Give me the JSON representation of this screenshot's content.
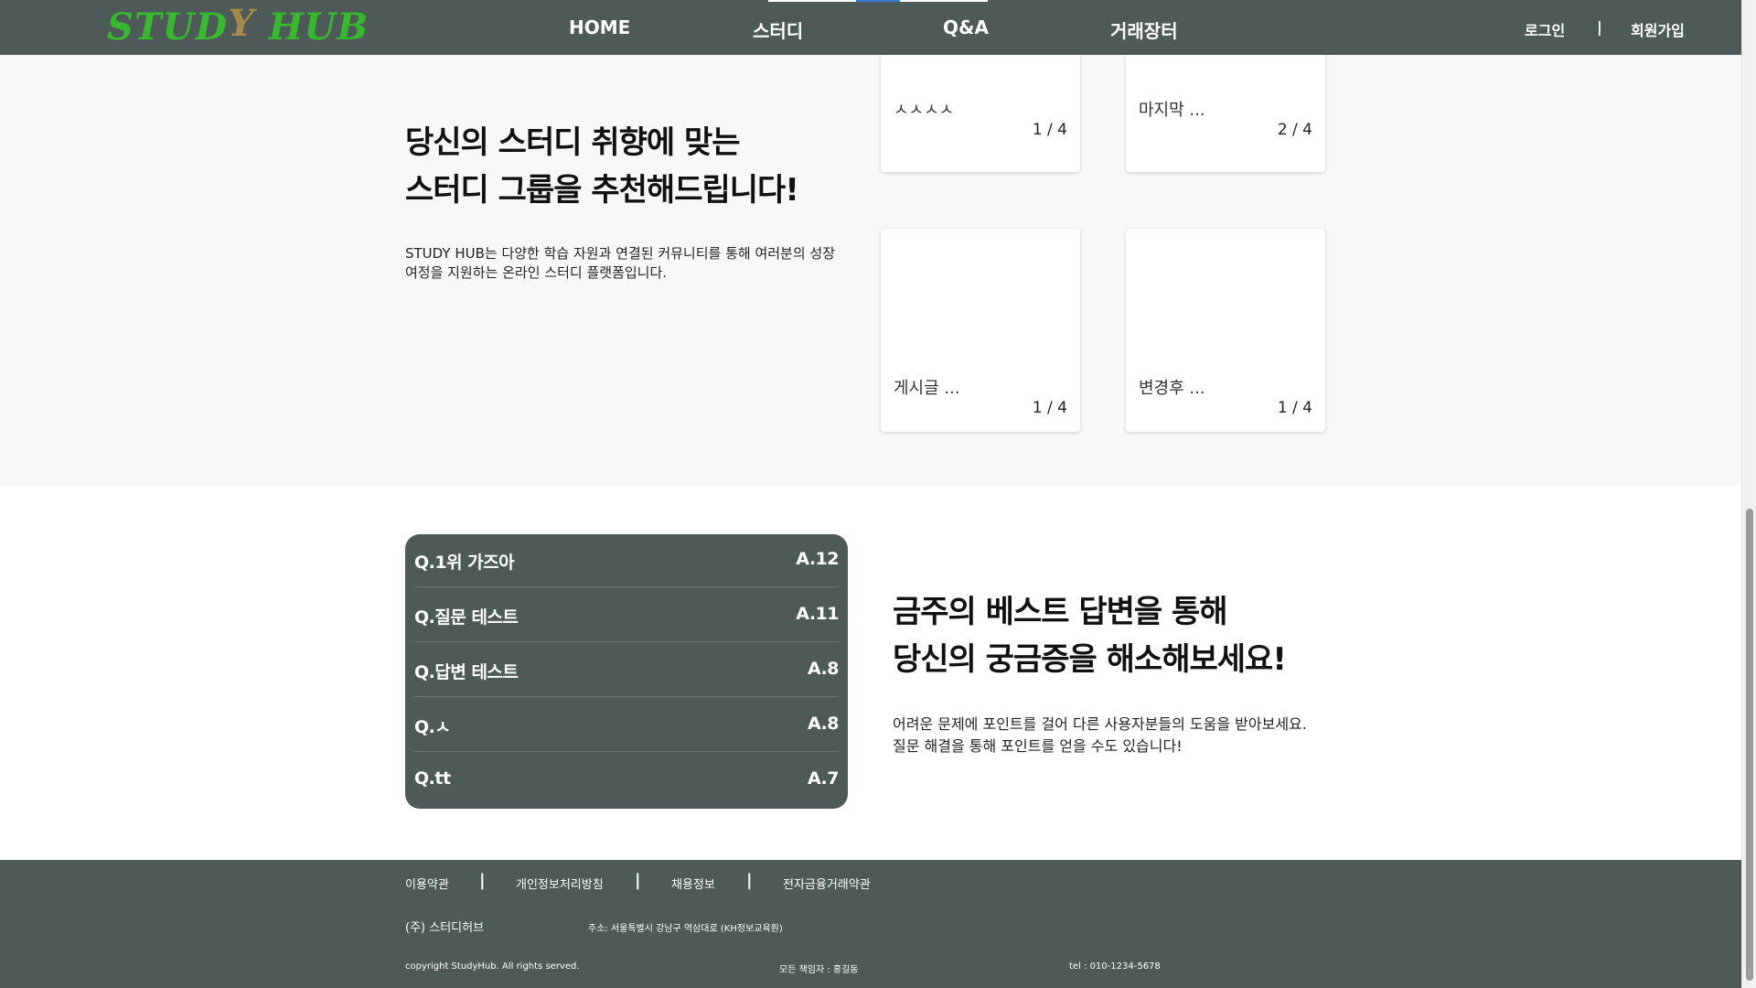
{
  "header": {
    "logo": {
      "part1": "STUD",
      "part2": "Y",
      "part3": " HUB"
    },
    "nav": [
      "HOME",
      "스터디",
      "Q&A",
      "거래장터"
    ],
    "login": "로그인",
    "separator": "|",
    "signup": "회원가입"
  },
  "study_section": {
    "headline_line1": "당신의 스터디 취향에 맞는",
    "headline_line2": "스터디 그룹을 추천해드립니다!",
    "description_line1": "STUDY HUB는 다양한 학습 자원과 연결된 커뮤니티를 통해 여러분의 성장",
    "description_line2": "여정을 지원하는 온라인 스터디 플랫폼입니다.",
    "cards": [
      {
        "title": "ㅅㅅㅅㅅ",
        "page": "1 / 4"
      },
      {
        "title": "마지막 ...",
        "page": "2 / 4"
      },
      {
        "title": "게시글 ...",
        "page": "1 / 4"
      },
      {
        "title": "변경후 ...",
        "page": "1 / 4"
      }
    ]
  },
  "qa_section": {
    "items": [
      {
        "question": "Q.1위 가즈아",
        "answers": "A.12"
      },
      {
        "question": "Q.질문 테스트",
        "answers": "A.11"
      },
      {
        "question": "Q.답변 테스트",
        "answers": "A.8"
      },
      {
        "question": "Q.ㅅ",
        "answers": "A.8"
      },
      {
        "question": "Q.tt",
        "answers": "A.7"
      }
    ],
    "headline_line1": "금주의 베스트 답변을 통해",
    "headline_line2": "당신의 궁금증을 해소해보세요!",
    "description_line1": "어려운 문제에 포인트를 걸어 다른 사용자분들의 도움을 받아보세요.",
    "description_line2": "질문 해결을 통해 포인트를 얻을 수도 있습니다!"
  },
  "footer": {
    "links": [
      "이용약관",
      "개인정보처리방침",
      "채용정보",
      "전자금융거래약관"
    ],
    "separator": "|",
    "company": "(주) 스터디허브",
    "address": "주소: 서울특별시 강남구 역삼대로 (KH정보교육원)",
    "copyright": "copyright StudyHub. All rights served.",
    "manager": "모든 책임자 : 홍길동",
    "tel": "tel : 010-1234-5678"
  },
  "colors": {
    "header_bg": "#4d5a58",
    "logo_green": "#37b82f",
    "logo_brown": "#a6894c",
    "section_bg": "#f8f8f8",
    "nav_active_line": "#3a7bd5"
  }
}
